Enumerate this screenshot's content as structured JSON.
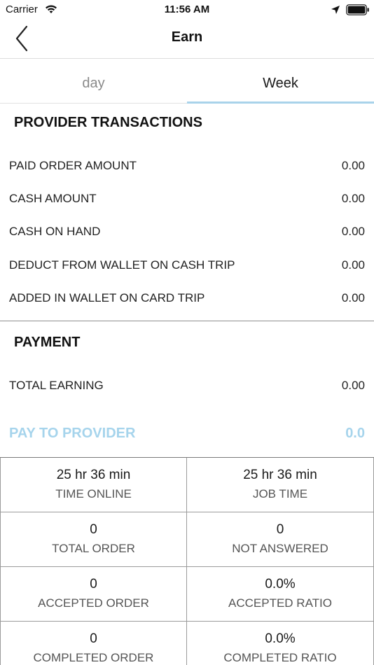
{
  "status_bar": {
    "carrier": "Carrier",
    "time": "11:56 AM"
  },
  "nav": {
    "title": "Earn"
  },
  "tabs": [
    {
      "label": "day",
      "selected": false
    },
    {
      "label": "Week",
      "selected": true
    }
  ],
  "provider_transactions": {
    "title": "PROVIDER TRANSACTIONS",
    "rows": [
      {
        "label": "PAID ORDER AMOUNT",
        "value": "0.00"
      },
      {
        "label": "CASH AMOUNT",
        "value": "0.00"
      },
      {
        "label": "CASH ON HAND",
        "value": "0.00"
      },
      {
        "label": "DEDUCT FROM WALLET ON CASH TRIP",
        "value": "0.00"
      },
      {
        "label": "ADDED IN WALLET ON CARD TRIP",
        "value": "0.00"
      }
    ]
  },
  "payment": {
    "title": "PAYMENT",
    "total_earning": {
      "label": "TOTAL EARNING",
      "value": "0.00"
    },
    "pay_to_provider": {
      "label": "PAY TO PROVIDER",
      "value": "0.0"
    }
  },
  "stats": [
    {
      "value": "25 hr 36 min",
      "label": "TIME ONLINE"
    },
    {
      "value": "25 hr 36 min",
      "label": "JOB TIME"
    },
    {
      "value": "0",
      "label": "TOTAL ORDER"
    },
    {
      "value": "0",
      "label": "NOT ANSWERED"
    },
    {
      "value": "0",
      "label": "ACCEPTED ORDER"
    },
    {
      "value": "0.0%",
      "label": "ACCEPTED RATIO"
    },
    {
      "value": "0",
      "label": "COMPLETED ORDER"
    },
    {
      "value": "0.0%",
      "label": "COMPLETED RATIO"
    }
  ],
  "colors": {
    "accent": "#a6d4ec",
    "tab_underline": "#a9d3ea",
    "text": "#1a1a1a",
    "muted": "#8a8a8a"
  },
  "icons": [
    "wifi-icon",
    "location-arrow-icon",
    "battery-icon",
    "back-chevron-icon"
  ]
}
